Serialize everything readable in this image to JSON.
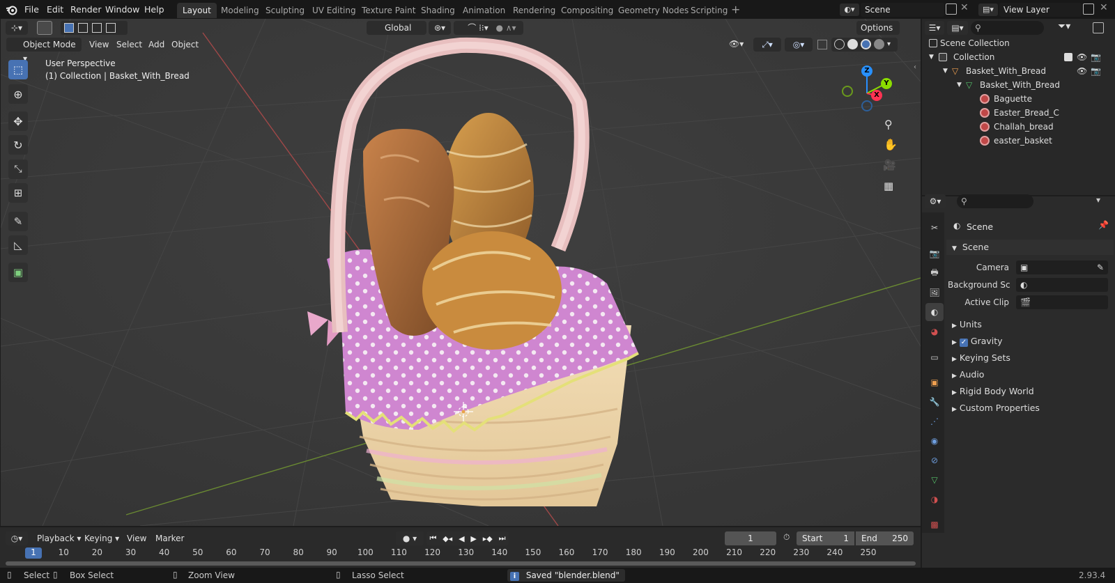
{
  "menus": [
    "File",
    "Edit",
    "Render",
    "Window",
    "Help"
  ],
  "workspaces": [
    "Layout",
    "Modeling",
    "Sculpting",
    "UV Editing",
    "Texture Paint",
    "Shading",
    "Animation",
    "Rendering",
    "Compositing",
    "Geometry Nodes",
    "Scripting"
  ],
  "active_workspace": "Layout",
  "scene_field": "Scene",
  "view_layer_field": "View Layer",
  "viewport": {
    "transform_orientation": "Global",
    "options_label": "Options",
    "mode": "Object Mode",
    "header_menus": [
      "View",
      "Select",
      "Add",
      "Object"
    ],
    "overlay_title": "User Perspective",
    "overlay_subtitle": "(1) Collection | Basket_With_Bread",
    "gizmo": {
      "z": "Z",
      "y": "Y",
      "x": "X"
    }
  },
  "outliner": {
    "rows": [
      {
        "label": "Scene Collection",
        "indent": 0,
        "icon": "scene-collection-icon"
      },
      {
        "label": "Collection",
        "indent": 1,
        "icon": "collection-icon"
      },
      {
        "label": "Basket_With_Bread",
        "indent": 2,
        "icon": "object-mesh-icon"
      },
      {
        "label": "Basket_With_Bread",
        "indent": 3,
        "icon": "mesh-data-icon"
      },
      {
        "label": "Baguette",
        "indent": 4,
        "icon": "material-icon"
      },
      {
        "label": "Easter_Bread_C",
        "indent": 4,
        "icon": "material-icon"
      },
      {
        "label": "Challah_bread",
        "indent": 4,
        "icon": "material-icon"
      },
      {
        "label": "easter_basket",
        "indent": 4,
        "icon": "material-icon"
      }
    ]
  },
  "properties": {
    "context": "Scene",
    "panel": "Scene",
    "fields": [
      {
        "label": "Camera",
        "value": ""
      },
      {
        "label": "Background Sce...",
        "value": ""
      },
      {
        "label": "Active Clip",
        "value": ""
      }
    ],
    "sections": [
      "Units",
      "Gravity",
      "Keying Sets",
      "Audio",
      "Rigid Body World",
      "Custom Properties"
    ],
    "gravity_checked": true
  },
  "timeline": {
    "menus": [
      "Playback",
      "Keying",
      "View",
      "Marker"
    ],
    "current_frame": "1",
    "start_label": "Start",
    "start": "1",
    "end_label": "End",
    "end": "250",
    "ruler": [
      "1",
      "10",
      "20",
      "30",
      "40",
      "50",
      "60",
      "70",
      "80",
      "90",
      "100",
      "110",
      "120",
      "130",
      "140",
      "150",
      "160",
      "170",
      "180",
      "190",
      "200",
      "210",
      "220",
      "230",
      "240",
      "250"
    ]
  },
  "status": {
    "select": "Select",
    "box_select": "Box Select",
    "zoom_view": "Zoom View",
    "lasso_select": "Lasso Select",
    "message": "Saved \"blender.blend\"",
    "version": "2.93.4"
  },
  "colors": {
    "accent": "#4772b3",
    "axis_x": "#ff3352",
    "axis_y": "#8bdc00",
    "axis_z": "#2890ff",
    "basket_cloth": "#d98ad6",
    "handle": "#e9c2c2"
  }
}
